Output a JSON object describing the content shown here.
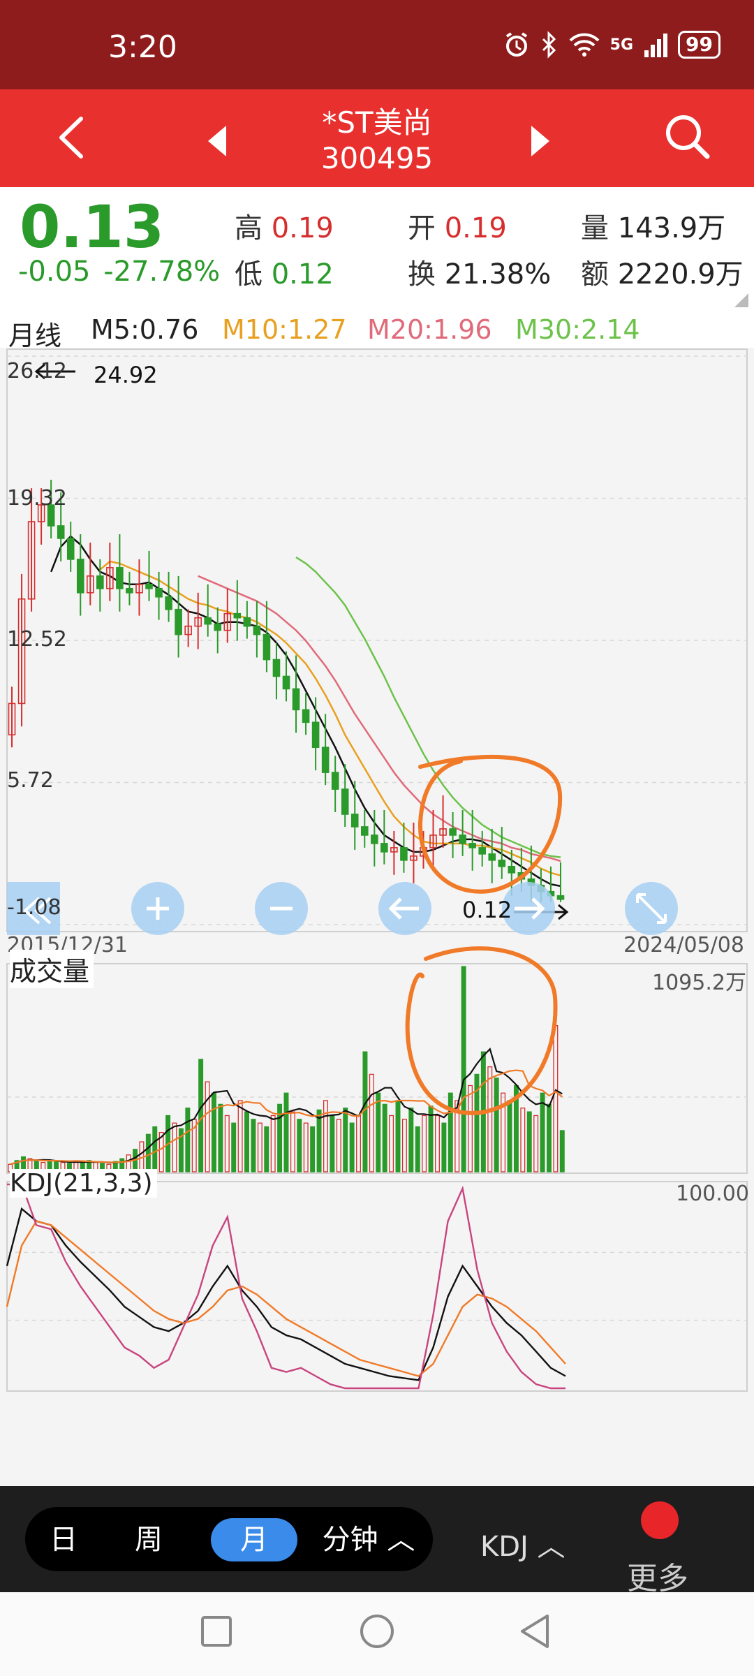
{
  "status": {
    "time": "3:20",
    "network": "5G",
    "battery": "99"
  },
  "header": {
    "stock_name": "*ST美尚",
    "stock_code": "300495"
  },
  "quote": {
    "price": "0.13",
    "change": "-0.05",
    "change_pct": "-27.78%",
    "high_label": "高",
    "high": "0.19",
    "low_label": "低",
    "low": "0.12",
    "open_label": "开",
    "open": "0.19",
    "turnover_label": "换",
    "turnover": "21.38%",
    "volume_label": "量",
    "volume": "143.9万",
    "amount_label": "额",
    "amount": "2220.9万"
  },
  "indicators": {
    "period": "月线",
    "m5": "M5:0.76",
    "m10": "M10:1.27",
    "m20": "M20:1.96",
    "m30": "M30:2.14"
  },
  "price_chart": {
    "y_labels": [
      "26.12",
      "19.32",
      "12.52",
      "5.72",
      "-1.08"
    ],
    "max_marker": "24.92",
    "min_marker": "0.12",
    "start_date": "2015/12/31",
    "end_date": "2024/05/08"
  },
  "volume_chart": {
    "title": "成交量",
    "max_label": "1095.2万"
  },
  "kdj_chart": {
    "title": "KDJ(21,3,3)",
    "max_label": "100.00"
  },
  "colors": {
    "up": "#d62e2e",
    "down": "#2a9a2a",
    "m5": "#111111",
    "m10": "#e8a020",
    "m20": "#e06a7a",
    "m30": "#6cc24a",
    "annotation": "#f07a28",
    "accent": "#3b8beb"
  },
  "chart_data": [
    {
      "type": "candlestick",
      "title": "月线",
      "x_range": [
        "2015/12/31",
        "2024/05/08"
      ],
      "ylim": [
        -1.08,
        26.12
      ],
      "y_ticks": [
        26.12,
        19.32,
        12.52,
        5.72,
        -1.08
      ],
      "period_max": 24.92,
      "period_min": 0.12,
      "close": [
        9.5,
        14.5,
        18.2,
        19.0,
        18.0,
        17.4,
        16.4,
        14.8,
        15.6,
        15.0,
        16.0,
        15.0,
        14.8,
        15.2,
        15.0,
        14.6,
        14.0,
        12.8,
        13.2,
        13.6,
        13.3,
        13.0,
        13.8,
        13.6,
        13.2,
        12.8,
        11.6,
        10.8,
        10.2,
        9.2,
        8.6,
        7.4,
        6.2,
        5.4,
        4.2,
        3.6,
        3.2,
        2.8,
        2.4,
        2.6,
        2.0,
        2.2,
        2.6,
        3.2,
        3.5,
        3.2,
        2.8,
        2.6,
        2.3,
        2.0,
        1.7,
        1.4,
        1.1,
        0.8,
        0.5,
        0.3,
        0.13
      ],
      "series": [
        {
          "name": "M5",
          "values": [
            null,
            null,
            null,
            null,
            15.8,
            17.0,
            17.5,
            17.1,
            16.4,
            15.8,
            15.6,
            15.3,
            15.2,
            15.2,
            15.3,
            15.0,
            14.7,
            14.3,
            13.9,
            13.8,
            13.6,
            13.3,
            13.4,
            13.4,
            13.3,
            13.2,
            12.9,
            12.4,
            11.8,
            11.0,
            10.1,
            9.2,
            8.3,
            7.4,
            6.4,
            5.4,
            4.5,
            3.8,
            3.2,
            2.9,
            2.6,
            2.4,
            2.4,
            2.5,
            2.7,
            2.9,
            3.0,
            3.0,
            2.9,
            2.6,
            2.3,
            2.0,
            1.7,
            1.4,
            1.1,
            0.85,
            0.76
          ]
        },
        {
          "name": "M10",
          "values": [
            null,
            null,
            null,
            null,
            null,
            null,
            null,
            null,
            null,
            15.9,
            16.3,
            16.2,
            16.0,
            15.8,
            15.6,
            15.4,
            15.1,
            14.8,
            14.5,
            14.3,
            14.2,
            14.0,
            13.9,
            13.7,
            13.6,
            13.4,
            13.1,
            12.8,
            12.4,
            11.9,
            11.4,
            10.7,
            9.9,
            9.0,
            8.0,
            7.2,
            6.4,
            5.6,
            4.8,
            4.1,
            3.6,
            3.2,
            2.9,
            2.8,
            2.8,
            2.8,
            2.8,
            2.7,
            2.7,
            2.6,
            2.5,
            2.3,
            2.1,
            1.9,
            1.6,
            1.4,
            1.27
          ]
        },
        {
          "name": "M20",
          "values": [
            null,
            null,
            null,
            null,
            null,
            null,
            null,
            null,
            null,
            null,
            null,
            null,
            null,
            null,
            null,
            null,
            null,
            null,
            null,
            15.6,
            15.4,
            15.2,
            15.0,
            14.8,
            14.6,
            14.4,
            14.1,
            13.8,
            13.4,
            13.0,
            12.5,
            11.9,
            11.3,
            10.6,
            9.8,
            9.0,
            8.3,
            7.6,
            6.9,
            6.2,
            5.6,
            5.1,
            4.6,
            4.2,
            3.9,
            3.6,
            3.4,
            3.2,
            3.0,
            2.9,
            2.8,
            2.6,
            2.5,
            2.3,
            2.2,
            2.1,
            1.96
          ]
        },
        {
          "name": "M30",
          "values": [
            null,
            null,
            null,
            null,
            null,
            null,
            null,
            null,
            null,
            null,
            null,
            null,
            null,
            null,
            null,
            null,
            null,
            null,
            null,
            null,
            null,
            null,
            null,
            null,
            null,
            null,
            null,
            null,
            null,
            16.5,
            16.2,
            15.8,
            15.3,
            14.8,
            14.2,
            13.4,
            12.6,
            11.7,
            10.8,
            9.8,
            8.9,
            8.0,
            7.1,
            6.3,
            5.6,
            5.0,
            4.5,
            4.1,
            3.7,
            3.4,
            3.1,
            2.9,
            2.7,
            2.5,
            2.3,
            2.2,
            2.14
          ]
        }
      ]
    },
    {
      "type": "bar",
      "title": "成交量",
      "unit": "万",
      "ymax": 1095.2,
      "values": [
        40,
        60,
        80,
        70,
        60,
        50,
        55,
        60,
        50,
        45,
        50,
        55,
        60,
        50,
        45,
        40,
        55,
        70,
        90,
        120,
        160,
        200,
        240,
        210,
        300,
        260,
        230,
        340,
        280,
        600,
        480,
        420,
        360,
        300,
        260,
        380,
        320,
        280,
        260,
        240,
        300,
        360,
        420,
        320,
        280,
        260,
        240,
        330,
        380,
        300,
        280,
        340,
        260,
        300,
        640,
        520,
        420,
        360,
        300,
        380,
        280,
        340,
        240,
        300,
        350,
        300,
        260,
        420,
        380,
        1095,
        460,
        520,
        640,
        560,
        500,
        420,
        380,
        460,
        340,
        320,
        300,
        420,
        360,
        780,
        220
      ]
    },
    {
      "type": "line",
      "title": "KDJ(21,3,3)",
      "ymax": 100,
      "series": [
        {
          "name": "K",
          "values": [
            60,
            88,
            82,
            80,
            70,
            62,
            55,
            48,
            40,
            35,
            30,
            28,
            32,
            38,
            50,
            60,
            48,
            40,
            30,
            26,
            24,
            20,
            16,
            12,
            10,
            8,
            6,
            5,
            4,
            20,
            45,
            60,
            50,
            40,
            32,
            26,
            18,
            10,
            6
          ]
        },
        {
          "name": "D",
          "values": [
            40,
            70,
            82,
            80,
            74,
            68,
            62,
            56,
            50,
            44,
            38,
            34,
            32,
            34,
            40,
            48,
            50,
            46,
            40,
            34,
            30,
            26,
            22,
            18,
            14,
            12,
            10,
            8,
            6,
            12,
            26,
            40,
            46,
            44,
            40,
            34,
            28,
            20,
            12
          ]
        },
        {
          "name": "J",
          "values": [
            100,
            100,
            80,
            78,
            62,
            50,
            40,
            30,
            20,
            16,
            10,
            14,
            30,
            46,
            70,
            84,
            44,
            28,
            10,
            8,
            10,
            6,
            2,
            0,
            0,
            0,
            0,
            0,
            0,
            36,
            82,
            98,
            58,
            32,
            18,
            8,
            2,
            0,
            0
          ]
        }
      ]
    }
  ]
}
